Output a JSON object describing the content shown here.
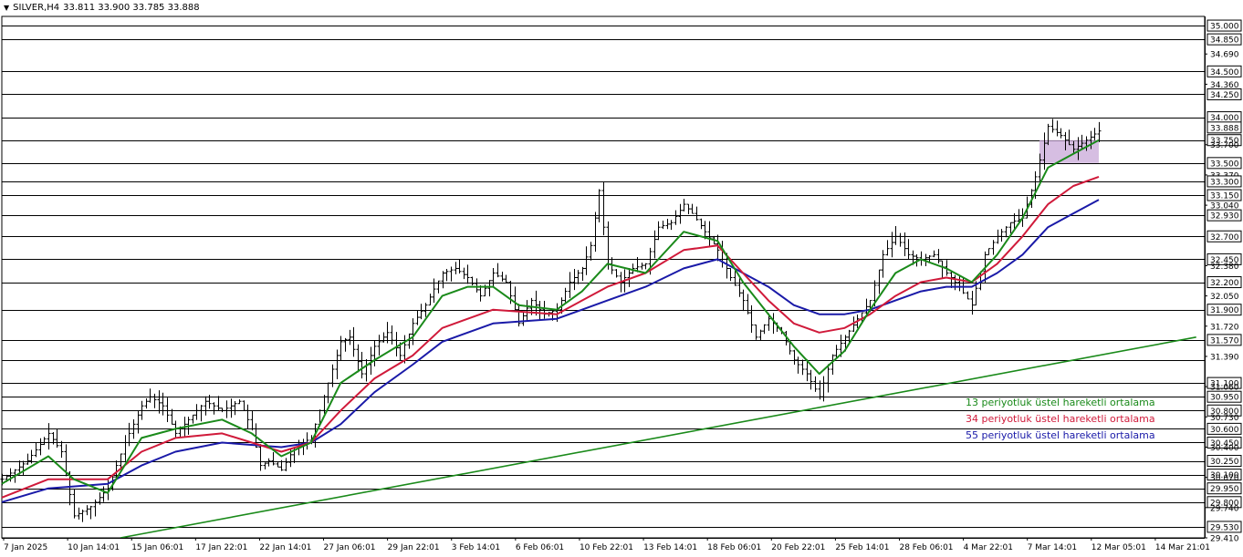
{
  "header": {
    "symbol": "SILVER,H4",
    "ohlc": "33.811 33.900 33.785 33.888",
    "menu_icon": "triangle-down-icon"
  },
  "legend": [
    {
      "text": "13 periyotluk üstel hareketli ortalama",
      "color": "#1a8a1a"
    },
    {
      "text": "34 periyotluk üstel hareketli ortalama",
      "color": "#d01a3a"
    },
    {
      "text": "55 periyotluk üstel hareketli ortalama",
      "color": "#1a1aa8"
    }
  ],
  "chart_data": {
    "type": "candlestick",
    "ylim": [
      29.41,
      35.1
    ],
    "price_ticks": [
      "35.000",
      "34.850",
      "34.690",
      "34.500",
      "34.360",
      "34.250",
      "34.000",
      "33.888",
      "33.750",
      "33.700",
      "33.500",
      "33.370",
      "33.300",
      "33.150",
      "33.040",
      "32.930",
      "32.700",
      "32.450",
      "32.380",
      "32.200",
      "32.050",
      "31.900",
      "31.720",
      "31.570",
      "31.390",
      "31.100",
      "31.060",
      "30.950",
      "30.800",
      "30.730",
      "30.600",
      "30.450",
      "30.400",
      "30.250",
      "30.100",
      "30.070",
      "29.950",
      "29.800",
      "29.740",
      "29.530",
      "29.410"
    ],
    "highlighted_ticks": [
      "35.000",
      "34.850",
      "34.500",
      "34.250",
      "34.000",
      "33.888",
      "33.750",
      "33.500",
      "33.300",
      "33.150",
      "32.930",
      "32.700",
      "32.450",
      "32.200",
      "31.900",
      "31.570",
      "31.100",
      "30.950",
      "30.800",
      "30.600",
      "30.450",
      "30.250",
      "30.100",
      "29.950",
      "29.800",
      "29.530"
    ],
    "horizontal_levels": [
      35.0,
      34.85,
      34.5,
      34.25,
      34.0,
      33.75,
      33.5,
      33.3,
      33.15,
      32.93,
      32.7,
      32.45,
      32.2,
      31.9,
      31.57,
      31.35,
      31.1,
      30.95,
      30.8,
      30.6,
      30.45,
      30.25,
      30.1,
      29.95,
      29.8,
      29.53
    ],
    "time_labels": [
      "7 Jan 2025",
      "10 Jan 14:01",
      "15 Jan 06:01",
      "17 Jan 22:01",
      "22 Jan 14:01",
      "27 Jan 06:01",
      "29 Jan 22:01",
      "3 Feb 14:01",
      "6 Feb 06:01",
      "10 Feb 22:01",
      "13 Feb 14:01",
      "18 Feb 06:01",
      "20 Feb 22:01",
      "25 Feb 14:01",
      "28 Feb 06:01",
      "4 Mar 22:01",
      "7 Mar 14:01",
      "12 Mar 05:01",
      "14 Mar 21:01"
    ],
    "price_path": [
      [
        0,
        30.05
      ],
      [
        6,
        30.25
      ],
      [
        11,
        30.55
      ],
      [
        14,
        30.35
      ],
      [
        17,
        29.65
      ],
      [
        21,
        29.75
      ],
      [
        25,
        29.95
      ],
      [
        29,
        30.45
      ],
      [
        33,
        30.85
      ],
      [
        35,
        30.95
      ],
      [
        38,
        30.85
      ],
      [
        41,
        30.55
      ],
      [
        44,
        30.7
      ],
      [
        48,
        30.9
      ],
      [
        52,
        30.8
      ],
      [
        56,
        30.9
      ],
      [
        59,
        30.6
      ],
      [
        61,
        30.2
      ],
      [
        63,
        30.25
      ],
      [
        66,
        30.15
      ],
      [
        69,
        30.4
      ],
      [
        73,
        30.5
      ],
      [
        76,
        30.95
      ],
      [
        80,
        31.55
      ],
      [
        82,
        31.6
      ],
      [
        85,
        31.2
      ],
      [
        88,
        31.5
      ],
      [
        91,
        31.65
      ],
      [
        94,
        31.4
      ],
      [
        97,
        31.75
      ],
      [
        100,
        31.95
      ],
      [
        104,
        32.3
      ],
      [
        107,
        32.35
      ],
      [
        110,
        32.25
      ],
      [
        113,
        32.05
      ],
      [
        116,
        32.3
      ],
      [
        119,
        32.2
      ],
      [
        122,
        31.75
      ],
      [
        125,
        32.0
      ],
      [
        128,
        31.85
      ],
      [
        131,
        31.9
      ],
      [
        134,
        32.2
      ],
      [
        137,
        32.35
      ],
      [
        139,
        32.6
      ],
      [
        141,
        33.2
      ],
      [
        143,
        32.4
      ],
      [
        146,
        32.2
      ],
      [
        149,
        32.35
      ],
      [
        152,
        32.4
      ],
      [
        155,
        32.8
      ],
      [
        158,
        32.85
      ],
      [
        161,
        33.05
      ],
      [
        163,
        32.95
      ],
      [
        166,
        32.75
      ],
      [
        169,
        32.55
      ],
      [
        172,
        32.25
      ],
      [
        175,
        32.0
      ],
      [
        178,
        31.6
      ],
      [
        181,
        31.8
      ],
      [
        184,
        31.65
      ],
      [
        187,
        31.35
      ],
      [
        190,
        31.2
      ],
      [
        193,
        30.95
      ],
      [
        196,
        31.4
      ],
      [
        199,
        31.6
      ],
      [
        202,
        31.8
      ],
      [
        205,
        32.0
      ],
      [
        208,
        32.5
      ],
      [
        211,
        32.7
      ],
      [
        214,
        32.5
      ],
      [
        217,
        32.45
      ],
      [
        220,
        32.5
      ],
      [
        223,
        32.3
      ],
      [
        226,
        32.15
      ],
      [
        229,
        31.95
      ],
      [
        232,
        32.5
      ],
      [
        235,
        32.7
      ],
      [
        238,
        32.85
      ],
      [
        241,
        32.9
      ],
      [
        244,
        33.35
      ],
      [
        247,
        33.9
      ],
      [
        250,
        33.8
      ],
      [
        253,
        33.65
      ],
      [
        256,
        33.75
      ],
      [
        259,
        33.85
      ]
    ],
    "ema13": [
      [
        0,
        30.0
      ],
      [
        11,
        30.3
      ],
      [
        17,
        30.05
      ],
      [
        25,
        29.9
      ],
      [
        33,
        30.5
      ],
      [
        41,
        30.6
      ],
      [
        52,
        30.7
      ],
      [
        59,
        30.55
      ],
      [
        66,
        30.3
      ],
      [
        73,
        30.45
      ],
      [
        80,
        31.1
      ],
      [
        88,
        31.35
      ],
      [
        97,
        31.6
      ],
      [
        104,
        32.05
      ],
      [
        110,
        32.15
      ],
      [
        116,
        32.15
      ],
      [
        122,
        31.95
      ],
      [
        131,
        31.9
      ],
      [
        137,
        32.1
      ],
      [
        143,
        32.4
      ],
      [
        152,
        32.3
      ],
      [
        161,
        32.75
      ],
      [
        169,
        32.65
      ],
      [
        175,
        32.2
      ],
      [
        181,
        31.85
      ],
      [
        187,
        31.5
      ],
      [
        193,
        31.2
      ],
      [
        199,
        31.45
      ],
      [
        205,
        31.9
      ],
      [
        211,
        32.3
      ],
      [
        217,
        32.45
      ],
      [
        223,
        32.35
      ],
      [
        229,
        32.2
      ],
      [
        235,
        32.5
      ],
      [
        241,
        32.9
      ],
      [
        247,
        33.45
      ],
      [
        253,
        33.6
      ],
      [
        259,
        33.75
      ]
    ],
    "ema34": [
      [
        0,
        29.85
      ],
      [
        11,
        30.05
      ],
      [
        25,
        30.05
      ],
      [
        33,
        30.35
      ],
      [
        41,
        30.5
      ],
      [
        52,
        30.55
      ],
      [
        66,
        30.35
      ],
      [
        73,
        30.45
      ],
      [
        80,
        30.8
      ],
      [
        88,
        31.15
      ],
      [
        97,
        31.4
      ],
      [
        104,
        31.7
      ],
      [
        116,
        31.9
      ],
      [
        131,
        31.85
      ],
      [
        143,
        32.15
      ],
      [
        152,
        32.3
      ],
      [
        161,
        32.55
      ],
      [
        169,
        32.6
      ],
      [
        175,
        32.3
      ],
      [
        181,
        32.0
      ],
      [
        187,
        31.75
      ],
      [
        193,
        31.65
      ],
      [
        199,
        31.7
      ],
      [
        205,
        31.85
      ],
      [
        211,
        32.05
      ],
      [
        217,
        32.2
      ],
      [
        223,
        32.25
      ],
      [
        229,
        32.2
      ],
      [
        235,
        32.4
      ],
      [
        241,
        32.7
      ],
      [
        247,
        33.05
      ],
      [
        253,
        33.25
      ],
      [
        259,
        33.35
      ]
    ],
    "ema55": [
      [
        0,
        29.8
      ],
      [
        11,
        29.95
      ],
      [
        25,
        30.0
      ],
      [
        33,
        30.2
      ],
      [
        41,
        30.35
      ],
      [
        52,
        30.45
      ],
      [
        66,
        30.4
      ],
      [
        73,
        30.45
      ],
      [
        80,
        30.65
      ],
      [
        88,
        31.0
      ],
      [
        97,
        31.3
      ],
      [
        104,
        31.55
      ],
      [
        116,
        31.75
      ],
      [
        131,
        31.8
      ],
      [
        143,
        32.0
      ],
      [
        152,
        32.15
      ],
      [
        161,
        32.35
      ],
      [
        169,
        32.45
      ],
      [
        175,
        32.3
      ],
      [
        181,
        32.15
      ],
      [
        187,
        31.95
      ],
      [
        193,
        31.85
      ],
      [
        199,
        31.85
      ],
      [
        205,
        31.9
      ],
      [
        211,
        32.0
      ],
      [
        217,
        32.1
      ],
      [
        223,
        32.15
      ],
      [
        229,
        32.15
      ],
      [
        235,
        32.3
      ],
      [
        241,
        32.5
      ],
      [
        247,
        32.8
      ],
      [
        253,
        32.95
      ],
      [
        259,
        33.1
      ]
    ],
    "trendline": {
      "from": [
        28,
        29.41
      ],
      "to": [
        282,
        31.6
      ],
      "color": "#1a8a1a"
    },
    "highlight_zone": {
      "x_start": 245,
      "x_end": 259,
      "y_low": 33.5,
      "y_high": 33.75,
      "color": "#c8a8d8"
    },
    "x_range": [
      0,
      284
    ],
    "grid": true
  }
}
